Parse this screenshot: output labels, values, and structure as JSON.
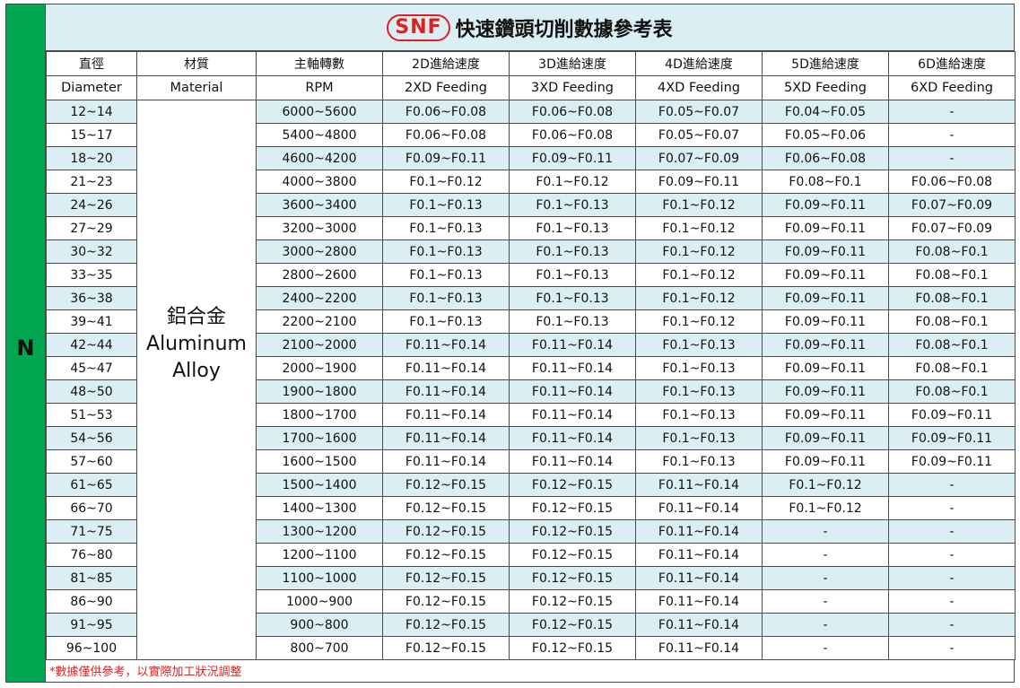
{
  "side_label": "N",
  "title": {
    "logo": "SNF",
    "text": "快速鑽頭切削數據參考表"
  },
  "headers_zh": [
    "直徑",
    "材質",
    "主軸轉數",
    "2D進給速度",
    "3D進給速度",
    "4D進給速度",
    "5D進給速度",
    "6D進給速度"
  ],
  "headers_en": [
    "Diameter",
    "Material",
    "RPM",
    "2XD Feeding",
    "3XD Feeding",
    "4XD Feeding",
    "5XD Feeding",
    "6XD Feeding"
  ],
  "material": {
    "zh": "鋁合金",
    "en1": "Aluminum",
    "en2": "Alloy"
  },
  "rows": [
    [
      "12~14",
      "6000~5600",
      "F0.06~F0.08",
      "F0.06~F0.08",
      "F0.05~F0.07",
      "F0.04~F0.05",
      "-"
    ],
    [
      "15~17",
      "5400~4800",
      "F0.06~F0.08",
      "F0.06~F0.08",
      "F0.05~F0.07",
      "F0.05~F0.06",
      "-"
    ],
    [
      "18~20",
      "4600~4200",
      "F0.09~F0.11",
      "F0.09~F0.11",
      "F0.07~F0.09",
      "F0.06~F0.08",
      "-"
    ],
    [
      "21~23",
      "4000~3800",
      "F0.1~F0.12",
      "F0.1~F0.12",
      "F0.09~F0.11",
      "F0.08~F0.1",
      "F0.06~F0.08"
    ],
    [
      "24~26",
      "3600~3400",
      "F0.1~F0.13",
      "F0.1~F0.13",
      "F0.1~F0.12",
      "F0.09~F0.11",
      "F0.07~F0.09"
    ],
    [
      "27~29",
      "3200~3000",
      "F0.1~F0.13",
      "F0.1~F0.13",
      "F0.1~F0.12",
      "F0.09~F0.11",
      "F0.07~F0.09"
    ],
    [
      "30~32",
      "3000~2800",
      "F0.1~F0.13",
      "F0.1~F0.13",
      "F0.1~F0.12",
      "F0.09~F0.11",
      "F0.08~F0.1"
    ],
    [
      "33~35",
      "2800~2600",
      "F0.1~F0.13",
      "F0.1~F0.13",
      "F0.1~F0.12",
      "F0.09~F0.11",
      "F0.08~F0.1"
    ],
    [
      "36~38",
      "2400~2200",
      "F0.1~F0.13",
      "F0.1~F0.13",
      "F0.1~F0.12",
      "F0.09~F0.11",
      "F0.08~F0.1"
    ],
    [
      "39~41",
      "2200~2100",
      "F0.1~F0.13",
      "F0.1~F0.13",
      "F0.1~F0.12",
      "F0.09~F0.11",
      "F0.08~F0.1"
    ],
    [
      "42~44",
      "2100~2000",
      "F0.11~F0.14",
      "F0.11~F0.14",
      "F0.1~F0.13",
      "F0.09~F0.11",
      "F0.08~F0.1"
    ],
    [
      "45~47",
      "2000~1900",
      "F0.11~F0.14",
      "F0.11~F0.14",
      "F0.1~F0.13",
      "F0.09~F0.11",
      "F0.08~F0.1"
    ],
    [
      "48~50",
      "1900~1800",
      "F0.11~F0.14",
      "F0.11~F0.14",
      "F0.1~F0.13",
      "F0.09~F0.11",
      "F0.08~F0.1"
    ],
    [
      "51~53",
      "1800~1700",
      "F0.11~F0.14",
      "F0.11~F0.14",
      "F0.1~F0.13",
      "F0.09~F0.11",
      "F0.09~F0.11"
    ],
    [
      "54~56",
      "1700~1600",
      "F0.11~F0.14",
      "F0.11~F0.14",
      "F0.1~F0.13",
      "F0.09~F0.11",
      "F0.09~F0.11"
    ],
    [
      "57~60",
      "1600~1500",
      "F0.11~F0.14",
      "F0.11~F0.14",
      "F0.1~F0.13",
      "F0.09~F0.11",
      "F0.09~F0.11"
    ],
    [
      "61~65",
      "1500~1400",
      "F0.12~F0.15",
      "F0.12~F0.15",
      "F0.11~F0.14",
      "F0.1~F0.12",
      "-"
    ],
    [
      "66~70",
      "1400~1300",
      "F0.12~F0.15",
      "F0.12~F0.15",
      "F0.11~F0.14",
      "F0.1~F0.12",
      "-"
    ],
    [
      "71~75",
      "1300~1200",
      "F0.12~F0.15",
      "F0.12~F0.15",
      "F0.11~F0.14",
      "-",
      "-"
    ],
    [
      "76~80",
      "1200~1100",
      "F0.12~F0.15",
      "F0.12~F0.15",
      "F0.11~F0.14",
      "-",
      "-"
    ],
    [
      "81~85",
      "1100~1000",
      "F0.12~F0.15",
      "F0.12~F0.15",
      "F0.11~F0.14",
      "-",
      "-"
    ],
    [
      "86~90",
      "1000~900",
      "F0.12~F0.15",
      "F0.12~F0.15",
      "F0.11~F0.14",
      "-",
      "-"
    ],
    [
      "91~95",
      "900~800",
      "F0.12~F0.15",
      "F0.12~F0.15",
      "F0.11~F0.14",
      "-",
      "-"
    ],
    [
      "96~100",
      "800~700",
      "F0.12~F0.15",
      "F0.12~F0.15",
      "F0.11~F0.14",
      "-",
      "-"
    ]
  ],
  "note": "*數據僅供參考，以實際加工狀況調整",
  "colors": {
    "green": "#00a650",
    "row_blue": "#daeef3",
    "accent_red": "#e02020",
    "border": "#4a4a4a"
  }
}
